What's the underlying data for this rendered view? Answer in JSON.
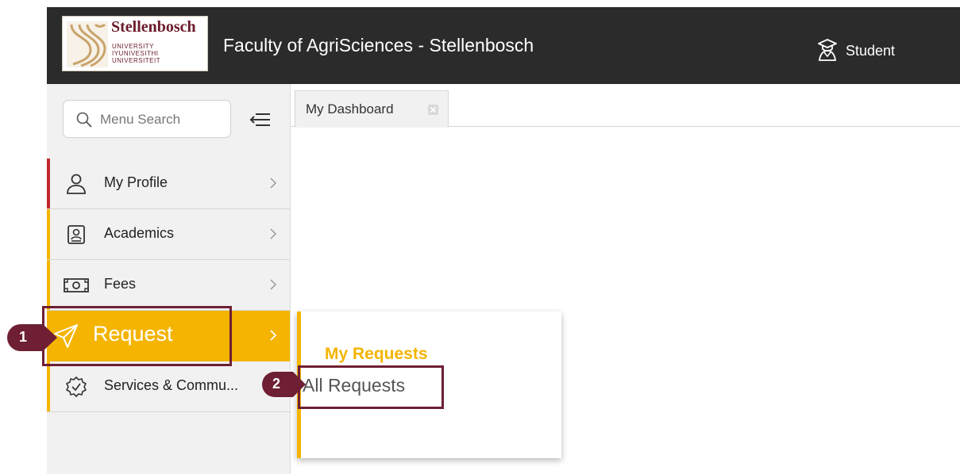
{
  "header": {
    "logo": {
      "name": "Stellenbosch",
      "lines": [
        "UNIVERSITY",
        "IYUNIVESITHI",
        "UNIVERSITEIT"
      ]
    },
    "title": "Faculty of AgriSciences - Stellenbosch",
    "role_label": "Student",
    "role_icon": "student-graduation-cap-icon"
  },
  "sidebar": {
    "search_placeholder": "Menu Search",
    "collapse_icon": "collapse-menu-icon",
    "items": [
      {
        "label": "My Profile",
        "icon": "user-icon",
        "accent": "#c0282d"
      },
      {
        "label": "Academics",
        "icon": "id-card-icon",
        "accent": "#f4b400"
      },
      {
        "label": "Fees",
        "icon": "banknote-icon",
        "accent": "#f4b400"
      },
      {
        "label": "Request",
        "icon": "paper-plane-icon",
        "active": true
      },
      {
        "label": "Services & Commu...",
        "icon": "badge-check-icon",
        "accent": "#f4b400"
      }
    ]
  },
  "tabs": [
    {
      "label": "My Dashboard",
      "closable": true
    }
  ],
  "flyout": {
    "heading": "My Requests",
    "items": [
      "All Requests"
    ]
  },
  "annotations": {
    "steps": [
      "1",
      "2"
    ],
    "color": "#6e1f34"
  },
  "colors": {
    "topbar": "#2b2b2b",
    "accent": "#f4b400",
    "brand": "#6b1a2a"
  }
}
